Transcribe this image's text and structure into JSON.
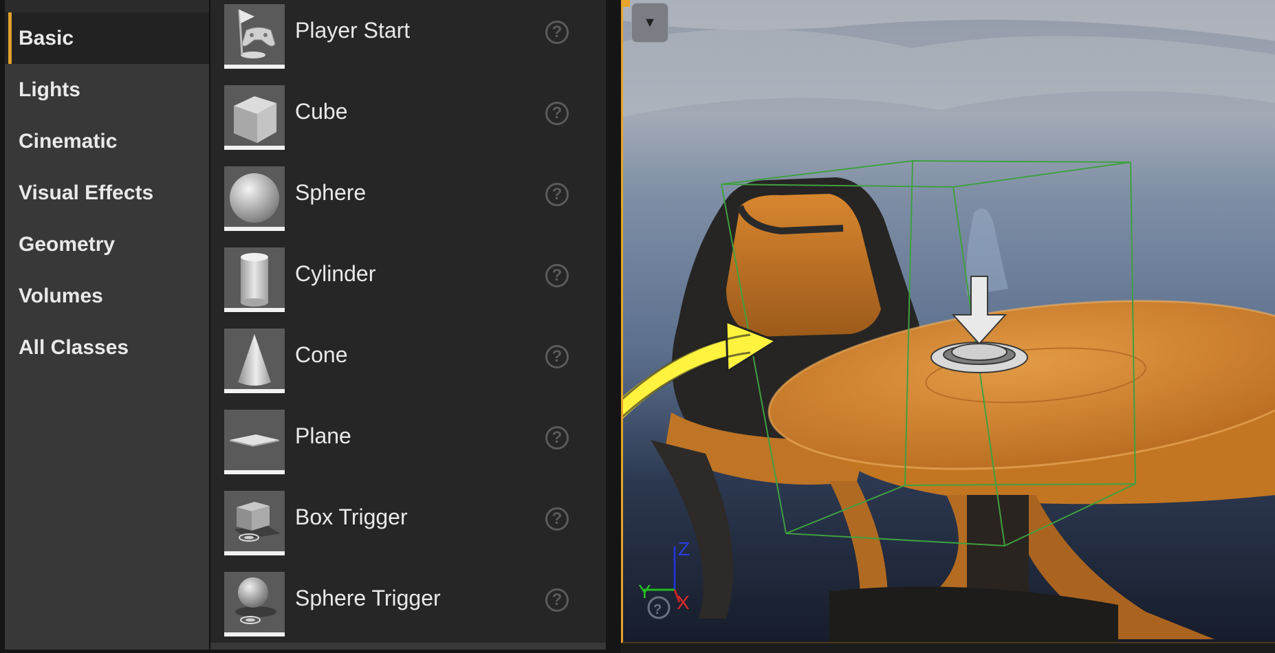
{
  "categories": [
    {
      "label": "Basic",
      "active": true
    },
    {
      "label": "Lights",
      "active": false
    },
    {
      "label": "Cinematic",
      "active": false
    },
    {
      "label": "Visual Effects",
      "active": false
    },
    {
      "label": "Geometry",
      "active": false
    },
    {
      "label": "Volumes",
      "active": false
    },
    {
      "label": "All Classes",
      "active": false
    }
  ],
  "actors": [
    {
      "label": "Player Start",
      "icon": "player-start-icon"
    },
    {
      "label": "Cube",
      "icon": "cube-icon"
    },
    {
      "label": "Sphere",
      "icon": "sphere-icon"
    },
    {
      "label": "Cylinder",
      "icon": "cylinder-icon"
    },
    {
      "label": "Cone",
      "icon": "cone-icon"
    },
    {
      "label": "Plane",
      "icon": "plane-icon"
    },
    {
      "label": "Box Trigger",
      "icon": "box-trigger-icon"
    },
    {
      "label": "Sphere Trigger",
      "icon": "sphere-trigger-icon"
    }
  ],
  "help_glyph": "?",
  "viewport": {
    "menu_glyph": "▼",
    "axis": {
      "z": "Z",
      "y": "Y",
      "x": "X"
    },
    "colors": {
      "accent": "#e6a52a",
      "bounds": "#3fa040",
      "arrow": "#fff33f",
      "wood": "#d98a2e"
    }
  }
}
